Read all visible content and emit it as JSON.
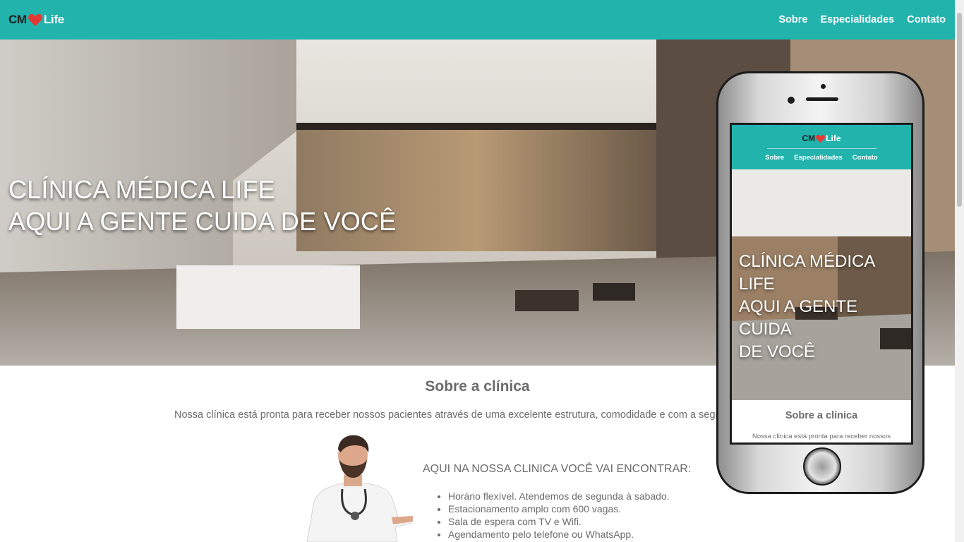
{
  "brand": {
    "prefix": "CM",
    "suffix": "Life",
    "heart_color": "#e53935"
  },
  "nav": {
    "items": [
      "Sobre",
      "Especialidades",
      "Contato"
    ]
  },
  "hero": {
    "line1": "CLÍNICA MÉDICA LIFE",
    "line2": "AQUI A GENTE CUIDA DE VOCÊ"
  },
  "about": {
    "title": "Sobre a clínica",
    "text": "Nossa clínica está pronta para receber nossos pacientes através de uma excelente estrutura, comodidade e com a segurança de qu"
  },
  "features": {
    "title": "AQUI NA NOSSA CLINICA VOCÊ VAI ENCONTRAR:",
    "items": [
      "Horário flexível. Atendemos de segunda à sabado.",
      "Estacionamento amplo com 600 vagas.",
      "Sala de espera com TV e Wifi.",
      "Agendamento pelo telefone ou WhatsApp."
    ]
  },
  "mobile": {
    "hero_line1": "CLÍNICA MÉDICA LIFE",
    "hero_line2": "AQUI A GENTE CUIDA",
    "hero_line3": "DE VOCÊ",
    "about_title": "Sobre a clínica",
    "about_text": "Nossa clínica está pronta para receber nossos"
  },
  "colors": {
    "primary": "#22b3ad",
    "text": "#6b6b6b"
  }
}
